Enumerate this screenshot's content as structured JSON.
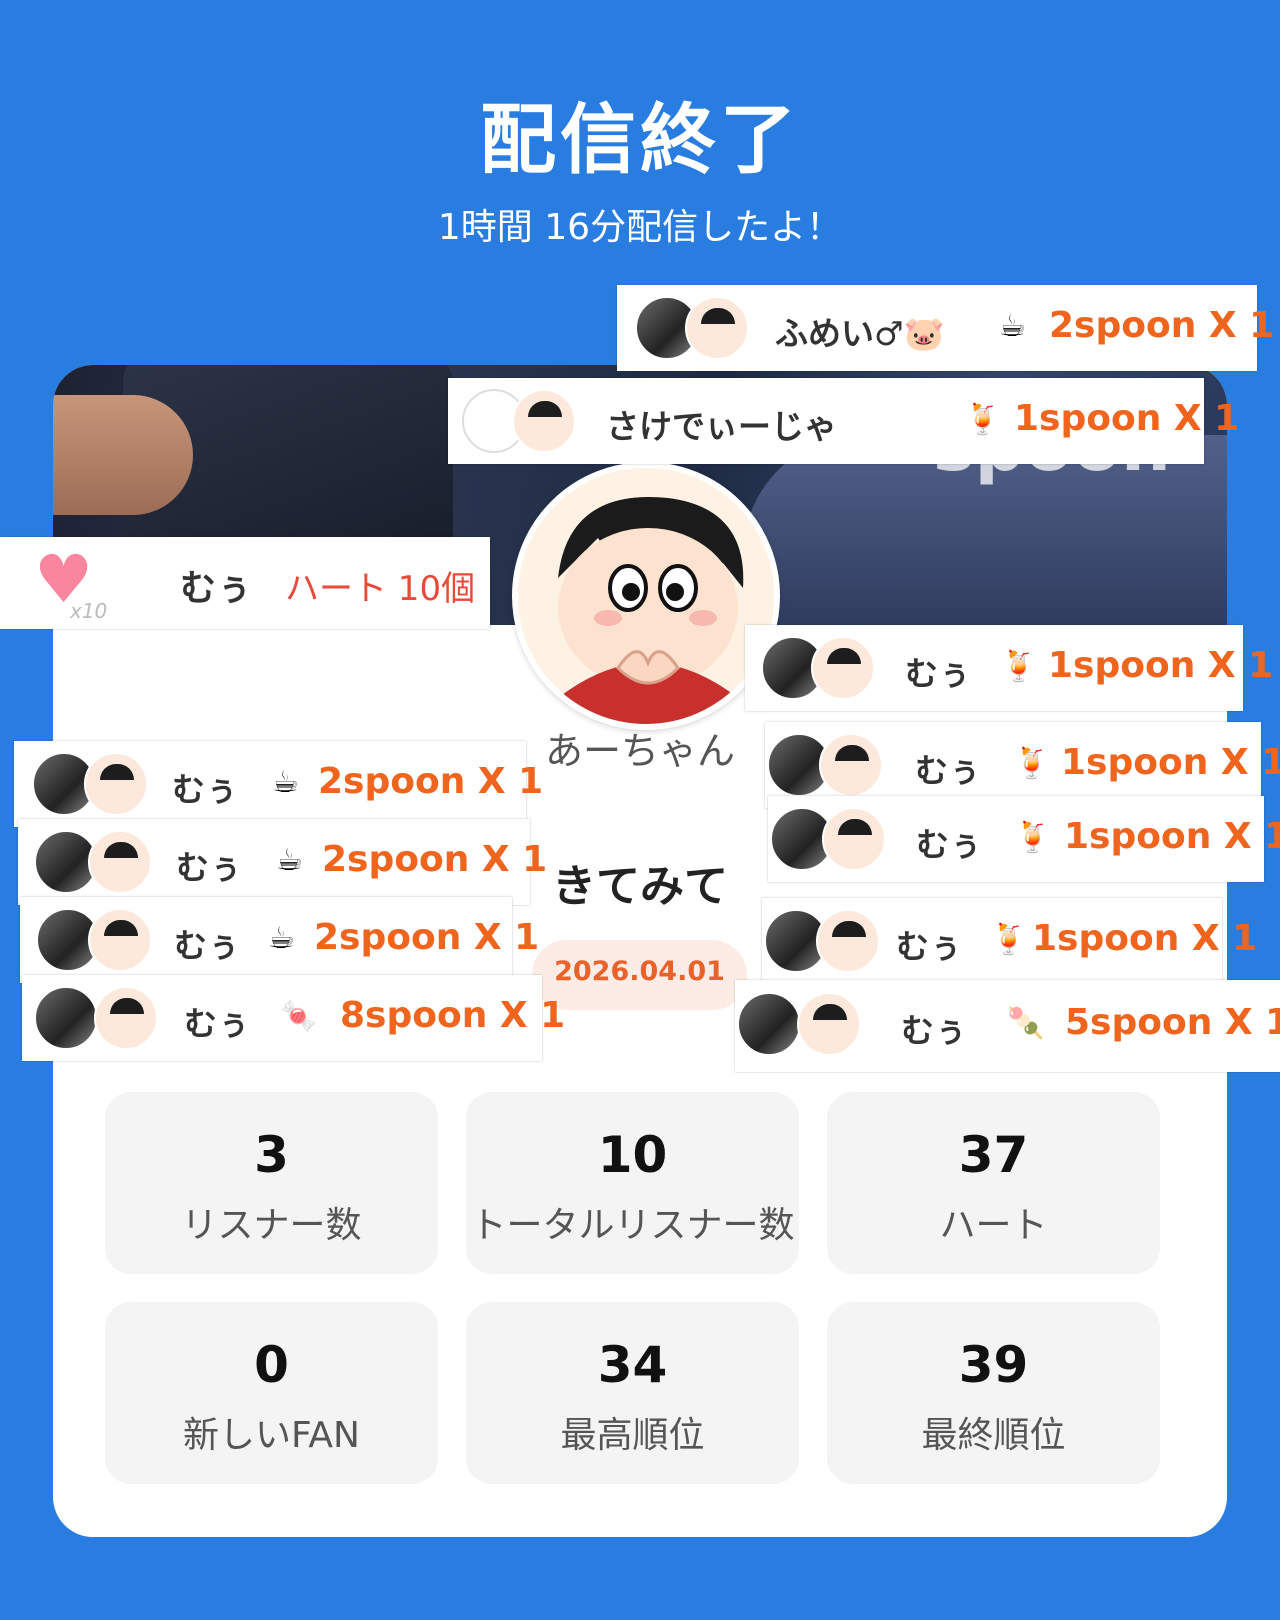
{
  "header": {
    "title": "配信終了",
    "subtitle": "1時間 16分配信したよ！"
  },
  "banner": {
    "watermark": "spoon"
  },
  "profile": {
    "name": "あーちゃん",
    "title": "きてみて",
    "date": "2026.04.01"
  },
  "heart_gift": {
    "user": "むぅ",
    "text": "ハート 10個",
    "multiplier": "x10"
  },
  "gifts": [
    {
      "user": "ふめい♂🐷",
      "icon": "☕",
      "amount": "2spoon X 1"
    },
    {
      "user": "さけでぃーじゃ",
      "icon": "🍹",
      "amount": "1spoon X 1"
    },
    {
      "user": "むぅ",
      "icon": "🍹",
      "amount": "1spoon X 1"
    },
    {
      "user": "むぅ",
      "icon": "☕",
      "amount": "2spoon X 1"
    },
    {
      "user": "むぅ",
      "icon": "🍹",
      "amount": "1spoon X 1"
    },
    {
      "user": "むぅ",
      "icon": "☕",
      "amount": "2spoon X 1"
    },
    {
      "user": "むぅ",
      "icon": "🍹",
      "amount": "1spoon X 1"
    },
    {
      "user": "むぅ",
      "icon": "☕",
      "amount": "2spoon X 1"
    },
    {
      "user": "むぅ",
      "icon": "🍹",
      "amount": "1spoon X 1"
    },
    {
      "user": "むぅ",
      "icon": "🍬",
      "amount": "8spoon X 1"
    },
    {
      "user": "むぅ",
      "icon": "🍡",
      "amount": "5spoon X 1"
    }
  ],
  "stats": [
    {
      "value": "3",
      "label": "リスナー数"
    },
    {
      "value": "10",
      "label": "トータルリスナー数"
    },
    {
      "value": "37",
      "label": "ハート"
    },
    {
      "value": "0",
      "label": "新しいFAN"
    },
    {
      "value": "34",
      "label": "最高順位"
    },
    {
      "value": "39",
      "label": "最終順位"
    }
  ],
  "colors": {
    "background": "#2a7de0",
    "amount": "#f0651e",
    "date": "#e8622a"
  }
}
